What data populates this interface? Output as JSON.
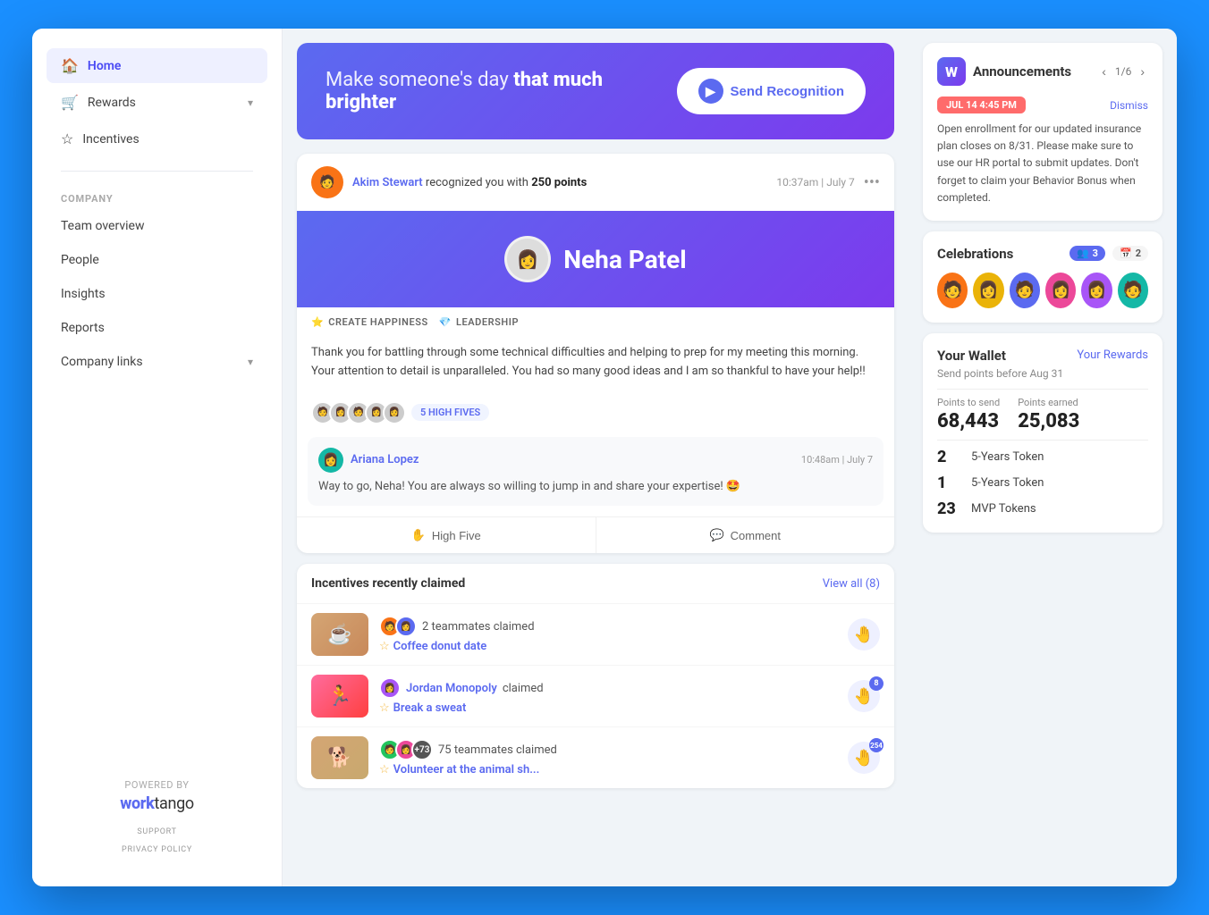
{
  "app": {
    "title": "WorkTango"
  },
  "sidebar": {
    "logo": "W",
    "logo_subtitle": "worktango",
    "powered_by": "POWERED BY",
    "support_label": "SUPPORT",
    "privacy_label": "PRIVACY POLICY",
    "nav_items": [
      {
        "id": "home",
        "label": "Home",
        "icon": "🏠",
        "active": true
      },
      {
        "id": "rewards",
        "label": "Rewards",
        "icon": "🛒",
        "has_chevron": true
      },
      {
        "id": "incentives",
        "label": "Incentives",
        "icon": "⭐",
        "has_chevron": false
      }
    ],
    "section_company": "COMPANY",
    "company_items": [
      {
        "id": "team-overview",
        "label": "Team overview"
      },
      {
        "id": "people",
        "label": "People"
      },
      {
        "id": "insights",
        "label": "Insights"
      },
      {
        "id": "reports",
        "label": "Reports"
      },
      {
        "id": "company-links",
        "label": "Company links",
        "has_chevron": true
      }
    ]
  },
  "hero": {
    "text_normal": "Make someone's day ",
    "text_bold": "that much brighter",
    "btn_label": "Send Recognition"
  },
  "recognition_card": {
    "sender_name": "Akim Stewart",
    "action_text": "recognized you with",
    "points": "250 points",
    "timestamp": "10:37am | July 7",
    "recipient_name": "Neha Patel",
    "tags": [
      {
        "icon": "⭐",
        "label": "CREATE HAPPINESS"
      },
      {
        "icon": "💎",
        "label": "LEADERSHIP"
      }
    ],
    "body_text": "Thank you for battling through some technical difficulties and helping to prep for my meeting this morning. Your attention to detail is unparalleled. You had so many good ideas and I am so thankful to have your help!!",
    "high_fives_label": "5 HIGH FIVES",
    "comment": {
      "author": "Ariana Lopez",
      "timestamp": "10:48am | July 7",
      "text": "Way to go, Neha! You are always so willing to jump in and share your expertise! 🤩"
    },
    "action_high_five": "High Five",
    "action_comment": "Comment"
  },
  "incentives": {
    "title": "Incentives recently claimed",
    "view_all_label": "View all (8)",
    "items": [
      {
        "id": "coffee",
        "thumb_type": "coffee",
        "thumb_emoji": "☕",
        "claimers_label": "2 teammates claimed",
        "incentive_name": "Coffee donut date",
        "hand_badge": null
      },
      {
        "id": "exercise",
        "thumb_type": "exercise",
        "thumb_emoji": "🏃",
        "claimer_name": "Jordan Monopoly",
        "claimed_label": "claimed",
        "incentive_name": "Break a sweat",
        "hand_badge": "8"
      },
      {
        "id": "animal",
        "thumb_type": "animal",
        "thumb_emoji": "🐕",
        "claimers_label": "+73",
        "teammates_label": "75 teammates claimed",
        "incentive_name": "Volunteer at the animal sh...",
        "hand_badge": "254"
      }
    ]
  },
  "announcements": {
    "title": "Announcements",
    "pagination_current": 1,
    "pagination_total": 6,
    "date_badge": "JUL 14 4:45 PM",
    "dismiss_label": "Dismiss",
    "body": "Open enrollment for our updated insurance plan closes on 8/31.  Please make sure to use our HR portal to submit updates. Don't forget to claim your Behavior Bonus when completed."
  },
  "celebrations": {
    "title": "Celebrations",
    "badge1_icon": "👥",
    "badge1_count": "3",
    "badge2_icon": "📅",
    "badge2_count": "2"
  },
  "wallet": {
    "title": "Your Wallet",
    "rewards_link": "Your Rewards",
    "subtitle": "Send points before Aug 31",
    "points_to_send_label": "Points to send",
    "points_to_send_value": "68,443",
    "points_earned_label": "Points earned",
    "points_earned_value": "25,083",
    "tokens": [
      {
        "count": "2",
        "label": "5-Years Token"
      },
      {
        "count": "1",
        "label": "5-Years Token"
      },
      {
        "count": "23",
        "label": "MVP Tokens"
      }
    ]
  }
}
